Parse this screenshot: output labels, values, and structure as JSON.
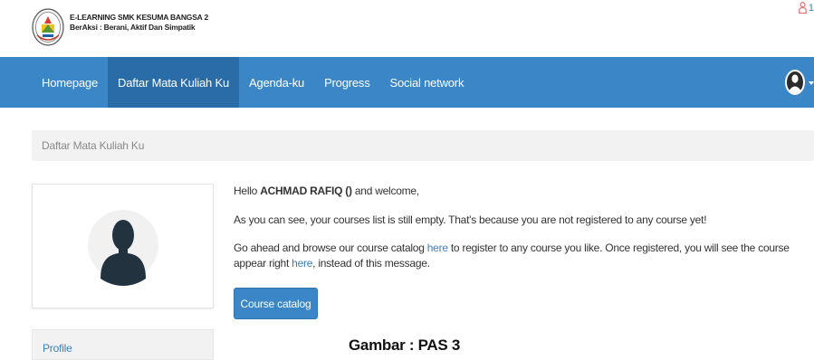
{
  "header": {
    "site_name": "E-LEARNING SMK KESUMA BANGSA 2",
    "tagline": "BerAksi : Berani, Aktif Dan Simpatik",
    "notification_count": "1"
  },
  "nav": {
    "items": [
      {
        "label": "Homepage"
      },
      {
        "label": "Daftar Mata Kuliah Ku"
      },
      {
        "label": "Agenda-ku"
      },
      {
        "label": "Progress"
      },
      {
        "label": "Social network"
      }
    ],
    "active_index": 1
  },
  "breadcrumb": {
    "current": "Daftar Mata Kuliah Ku"
  },
  "sidebar": {
    "menu_item": "Profile"
  },
  "main": {
    "greeting_prefix": "Hello ",
    "user_name": "ACHMAD RAFIQ ()",
    "greeting_suffix": " and welcome,",
    "empty_message": "As you can see, your courses list is still empty. That's because you are not registered to any course yet!",
    "browse_prefix": "Go ahead and browse our course catalog ",
    "browse_link": "here",
    "browse_middle": " to register to any course you like. Once registered, you will see the course appear right ",
    "here_link": "here",
    "browse_suffix": ", instead of this message.",
    "catalog_button": "Course catalog"
  },
  "caption": "Gambar : PAS 3",
  "colors": {
    "navbar": "#3b86c6",
    "navbar_active": "#2a6ca7",
    "link": "#3a7fc1",
    "breadcrumb_bg": "#f2f2f2"
  }
}
